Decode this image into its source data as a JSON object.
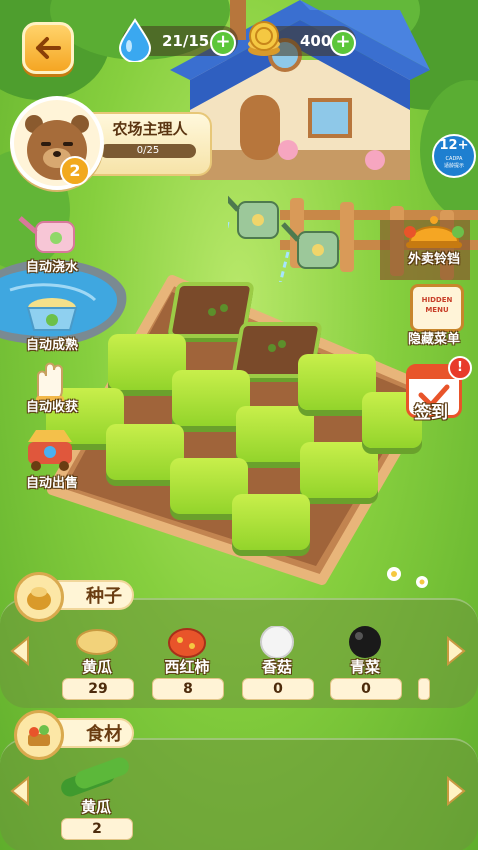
{
  "header": {
    "water": "21/15",
    "coins": "400",
    "back_icon": "arrow-left-icon",
    "water_icon": "water-drop-icon",
    "coin_icon": "coin-stack-icon"
  },
  "profile": {
    "level": "2",
    "name": "农场主理人",
    "exp": "0/25",
    "exp_progress": 0
  },
  "age_rating": {
    "label": "12+",
    "sub1": "CADPA",
    "sub2": "适龄提示"
  },
  "left_actions": [
    {
      "label": "自动浇水",
      "icon": "watering-can-icon"
    },
    {
      "label": "自动成熟",
      "icon": "fertilizer-bowl-icon"
    },
    {
      "label": "自动收获",
      "icon": "glove-hand-icon"
    },
    {
      "label": "自动出售",
      "icon": "market-cart-icon"
    }
  ],
  "right_actions": [
    {
      "label": "外卖铃铛",
      "icon": "service-bell-icon"
    },
    {
      "label": "隐藏菜单",
      "icon": "hidden-menu-board-icon",
      "sign_text": "HIDDEN MENU"
    },
    {
      "label": "签到",
      "icon": "calendar-check-icon",
      "badge": "!"
    }
  ],
  "seeds": {
    "title": "种子",
    "items": [
      {
        "name": "黄瓜",
        "count": "29",
        "color": "#f2d27a"
      },
      {
        "name": "西红柿",
        "count": "8",
        "color": "#e8542a"
      },
      {
        "name": "香菇",
        "count": "0",
        "color": "#f4f4f4"
      },
      {
        "name": "青菜",
        "count": "0",
        "color": "#1a1a1a"
      }
    ]
  },
  "ingredients": {
    "title": "食材",
    "items": [
      {
        "name": "黄瓜",
        "count": "2"
      }
    ]
  },
  "colors": {
    "accent_green": "#5cc63a",
    "tile_green": "#a8dc34",
    "soil": "#a0643a",
    "panel_text": "#6a3d12"
  }
}
